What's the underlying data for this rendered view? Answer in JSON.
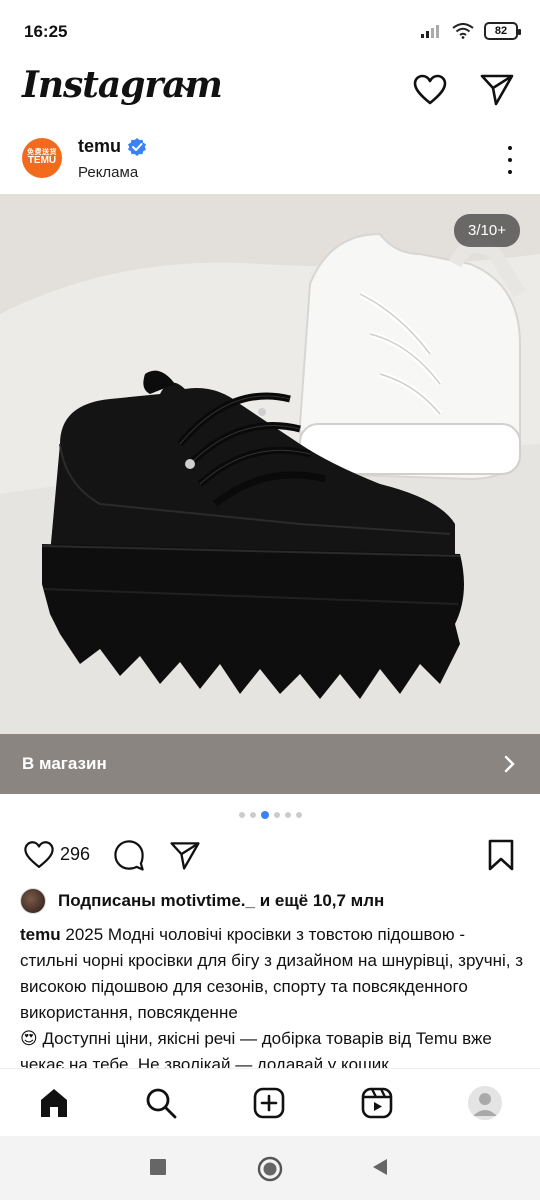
{
  "status_bar": {
    "time": "16:25",
    "battery": "82"
  },
  "header": {
    "logo": "Instagram"
  },
  "post": {
    "username": "temu",
    "sponsored_label": "Реклама",
    "avatar_text_small": "免费送货",
    "avatar_text": "TEMU",
    "media_counter": "3/10+",
    "cta_label": "В магазин",
    "likes": "296",
    "followed_by": "Подписаны motivtime._ и ещё 10,7 млн",
    "caption_user": "temu",
    "caption_text": "2025 Модні чоловічі кросівки з товстою підошвою - стильні чорні кросівки для бігу з дизайном на шнурівці, зручні, з високою підошвою для сезонів, спорту та повсякденного використання, повсякденне",
    "caption_line2": "😍 Доступні ціни, якісні речі — добірка товарів від Temu вже чекає на тебе. Не зволікай — додавай у кошик",
    "carousel": {
      "count": 6,
      "active": 2
    }
  },
  "colors": {
    "accent": "#3b82f6",
    "brand": "#f26a1b",
    "cta_bg": "#8a8580"
  }
}
